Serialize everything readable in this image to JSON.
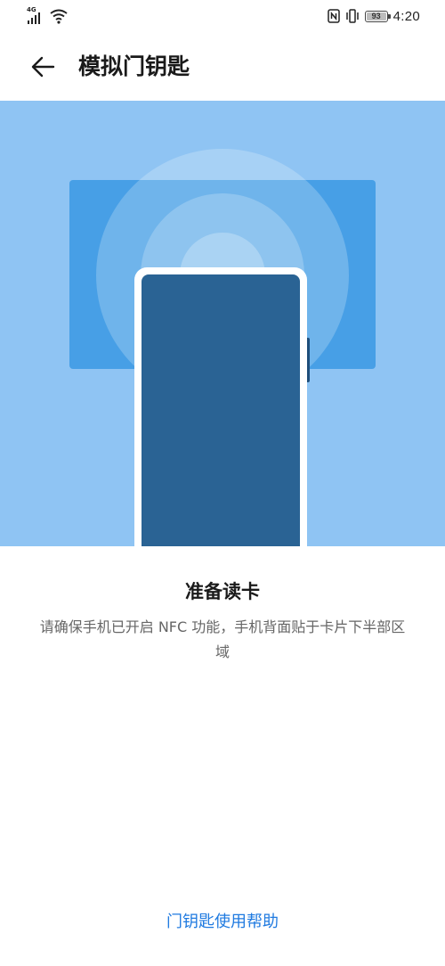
{
  "status_bar": {
    "network_type": "4G",
    "battery_level": "93",
    "time": "4:20",
    "icons": [
      "signal-icon",
      "wifi-icon",
      "nfc-icon",
      "vibrate-icon",
      "battery-icon"
    ]
  },
  "header": {
    "back_icon": "arrow-left-icon",
    "title": "模拟门钥匙"
  },
  "illustration": {
    "colors": {
      "background": "#8fc4f3",
      "card": "#479fe6",
      "phone_frame": "#ffffff",
      "phone_screen": "#2a6394",
      "rings": "#c6e2fa"
    }
  },
  "main": {
    "title": "准备读卡",
    "description": "请确保手机已开启 NFC 功能，手机背面贴于卡片下半部区域"
  },
  "footer": {
    "help_link": "门钥匙使用帮助"
  },
  "colors": {
    "accent": "#1f7ae0",
    "text_primary": "#1a1a1a",
    "text_secondary": "#666666"
  }
}
